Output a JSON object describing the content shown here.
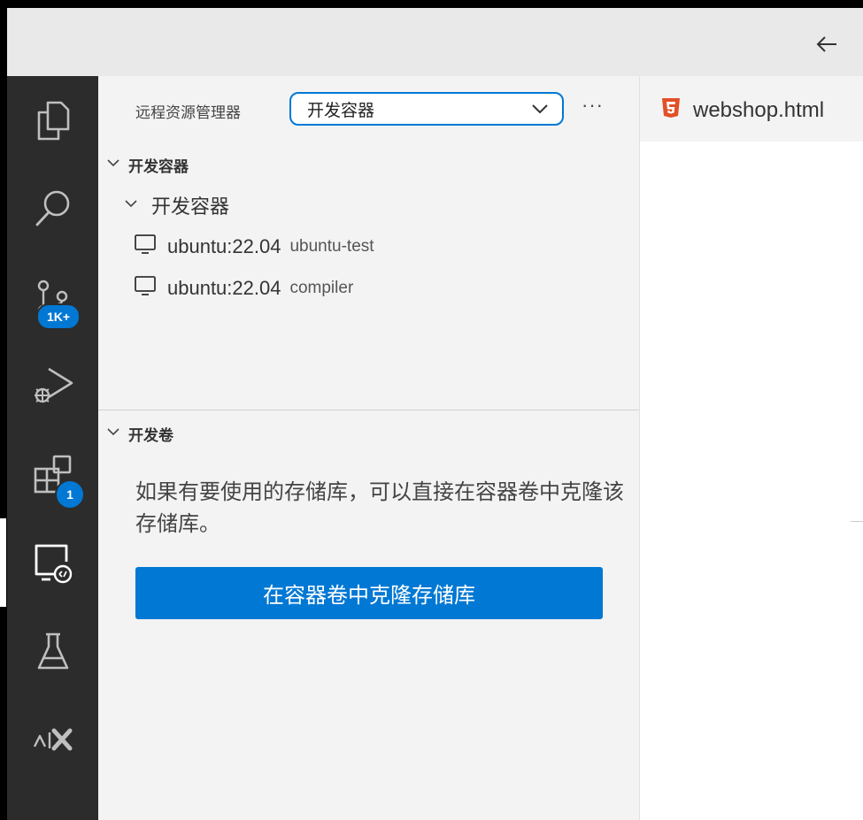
{
  "titlebar": {
    "back_icon": "arrow-left-icon"
  },
  "activity_bar": {
    "items": [
      {
        "name": "explorer",
        "icon": "files-icon"
      },
      {
        "name": "search",
        "icon": "search-icon"
      },
      {
        "name": "source-control",
        "icon": "source-control-icon",
        "badge": "1K+"
      },
      {
        "name": "run-debug",
        "icon": "run-debug-icon"
      },
      {
        "name": "extensions",
        "icon": "extensions-icon",
        "badge": "1"
      },
      {
        "name": "remote-explorer",
        "icon": "remote-explorer-icon",
        "active": true
      },
      {
        "name": "testing",
        "icon": "flask-icon"
      },
      {
        "name": "ai",
        "icon": "ai-x-icon"
      }
    ]
  },
  "sidebar": {
    "title": "远程资源管理器",
    "select_value": "开发容器",
    "more_label": "···",
    "containers_section": {
      "title": "开发容器",
      "group_label": "开发容器",
      "items": [
        {
          "label": "ubuntu:22.04",
          "description": "ubuntu-test"
        },
        {
          "label": "ubuntu:22.04",
          "description": "compiler"
        }
      ]
    },
    "volumes_section": {
      "title": "开发卷",
      "message": "如果有要使用的存储库，可以直接在容器卷中克隆该存储库。",
      "button_label": "在容器卷中克隆存储库"
    }
  },
  "editor": {
    "tab_label": "webshop.html",
    "tab_icon": "html5-icon"
  },
  "colors": {
    "accent": "#0078d4",
    "activity_bar_bg": "#2c2c2c",
    "sidebar_bg": "#f3f3f3",
    "html5_orange": "#e34f26"
  }
}
